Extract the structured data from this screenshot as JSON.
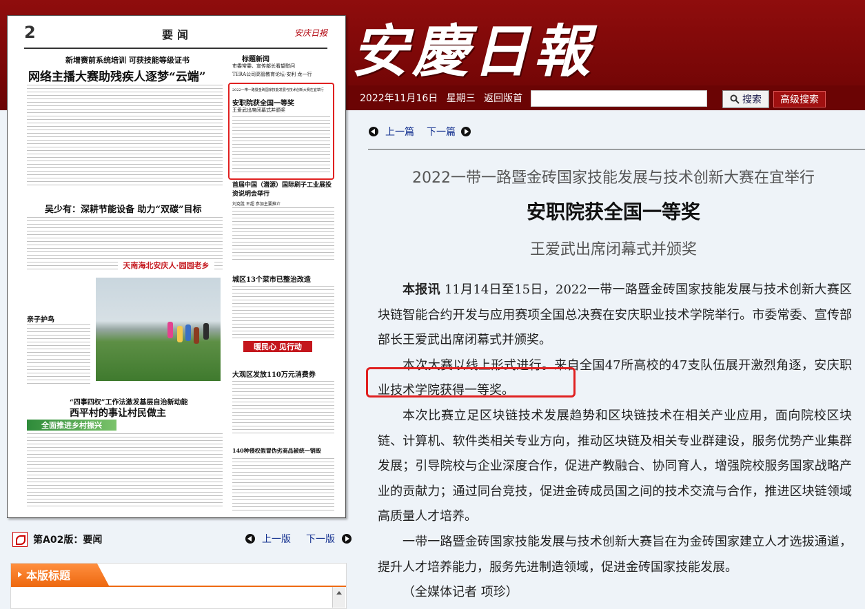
{
  "header": {
    "masthead": "安慶日報",
    "date": "2022年11月16日",
    "weekday": "星期三",
    "home_link": "返回版首",
    "search_label": "搜索",
    "advanced_search_label": "高级搜索",
    "search_value": ""
  },
  "paper": {
    "page_number": "2",
    "section": "要闻",
    "logo": "安庆日报",
    "h1_kicker": "新增赛前系统培训 可获技能等级证书",
    "h1": "网络主播大赛助残疾人逐梦“云端”",
    "h2": "吴少有：深耕节能设备 助力“双碳”目标",
    "h3_kicker": "“四事四权”工作法激发基层自治新动能",
    "h3": "西平村的事让村民做主",
    "side_title": "标题新闻",
    "side_items": [
      "市委常委、宣传部长看望慰问",
      "TERA公司高管教育论坛·安利 龙一行"
    ],
    "boxed_kicker": "2022一带一路暨金砖国家技能发展与技术创新大赛在宜举行",
    "boxed_title": "安职院获全国一等奖",
    "boxed_sub": "王爱武出席闭幕式并颁奖",
    "r1": "首届中国（潜源）国际刷子工业展投资说明会举行",
    "r1_sub": "刘克胜 王超 参加主要推介",
    "r2": "城区13个菜市已整治改造",
    "r3": "大观区发放110万元消费券",
    "r4": "140种侵权假冒伪劣商品被统一销毁",
    "photo_caption": "亲子护鸟",
    "red_band_1": "天南海北安庆人·园园老乡",
    "red_band_2": "暖民心 见行动",
    "green_band": "全面推进乡村振兴"
  },
  "edition": {
    "label": "第A02版：要闻",
    "prev": "上一版",
    "next": "下一版",
    "titles_tab": "本版标题"
  },
  "article": {
    "prev": "上一篇",
    "next": "下一篇",
    "pre_title": "2022一带一路暨金砖国家技能发展与技术创新大赛在宜举行",
    "title": "安职院获全国一等奖",
    "subtitle": "王爱武出席闭幕式并颁奖",
    "lead_tag": "本报讯",
    "p1": "11月14日至15日，2022一带一路暨金砖国家技能发展与技术创新大赛区块链智能合约开发与应用赛项全国总决赛在安庆职业技术学院举行。市委常委、宣传部部长王爱武出席闭幕式并颁奖。",
    "p2": "本次大赛以线上形式进行。来自全国47所高校的47支队伍展开激烈角逐，安庆职业技术学院获得一等奖。",
    "p3": "本次比赛立足区块链技术发展趋势和区块链技术在相关产业应用，面向院校区块链、计算机、软件类相关专业方向，推动区块链及相关专业群建设，服务优势产业集群发展；引导院校与企业深度合作，促进产教融合、协同育人，增强院校服务国家战略产业的贡献力；通过同台竞技，促进金砖成员国之间的技术交流与合作，推进区块链领域高质量人才培养。",
    "p4": "一带一路暨金砖国家技能发展与技术创新大赛旨在为金砖国家建立人才选拔通道，提升人才培养能力，服务先进制造领域，促进金砖国家技能发展。",
    "byline": "（全媒体记者 项珍）"
  },
  "colors": {
    "banner": "#8f0d0d",
    "highlight": "#e02020",
    "link": "#13308f",
    "tab": "#ee6a12"
  }
}
